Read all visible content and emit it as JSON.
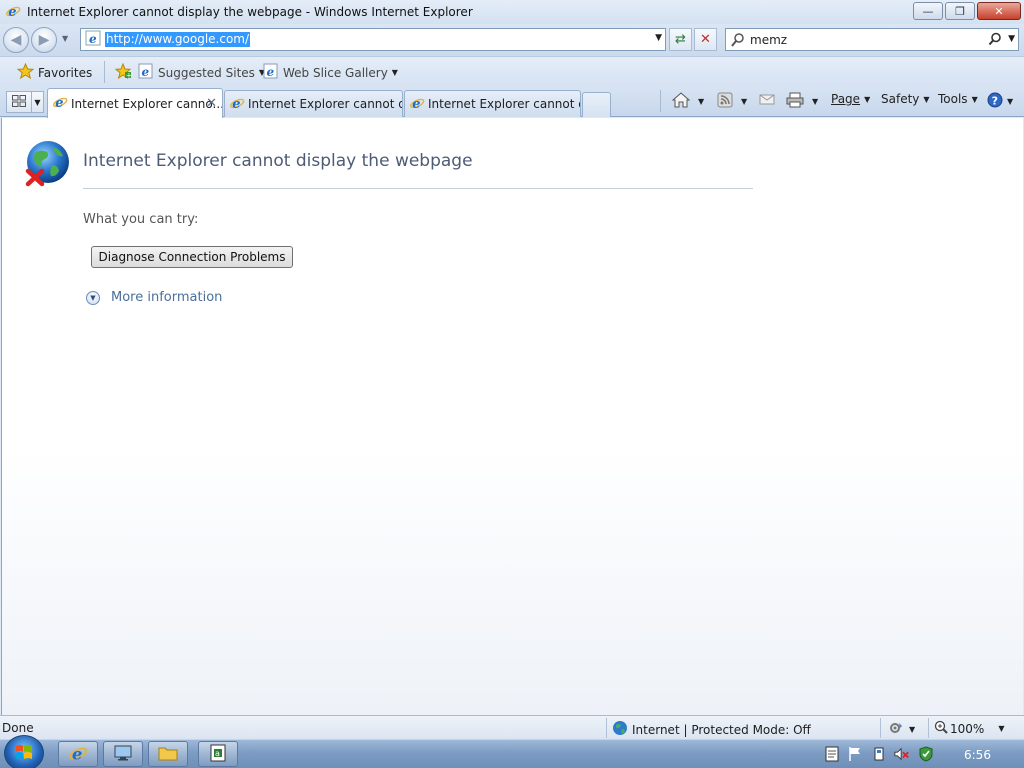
{
  "window": {
    "title": "Internet Explorer cannot display the webpage - Windows Internet Explorer",
    "icon": "ie-icon"
  },
  "navigation": {
    "address": "http://www.google.com/",
    "search_value": "memz"
  },
  "favorites_bar": {
    "favorites_label": "Favorites",
    "items": [
      {
        "label": "Suggested Sites",
        "icon": "ie-page-icon"
      },
      {
        "label": "Web Slice Gallery",
        "icon": "ie-page-icon"
      }
    ]
  },
  "tabs": [
    {
      "label": "Internet Explorer canno...",
      "active": true
    },
    {
      "label": "Internet Explorer cannot di...",
      "active": false
    },
    {
      "label": "Internet Explorer cannot di...",
      "active": false
    }
  ],
  "command_bar": {
    "page_label": "Page",
    "safety_label": "Safety",
    "tools_label": "Tools"
  },
  "content": {
    "heading": "Internet Explorer cannot display the webpage",
    "try_label": "What you can try:",
    "diagnose_button": "Diagnose Connection Problems",
    "more_info": "More information"
  },
  "status_bar": {
    "status_text": "Done",
    "zone_text": "Internet | Protected Mode: Off",
    "zoom": "100%"
  },
  "taskbar": {
    "clock": "6:56"
  },
  "colors": {
    "accent": "#3399ff",
    "link": "#4a6f9b",
    "heading": "#4d5b75"
  }
}
